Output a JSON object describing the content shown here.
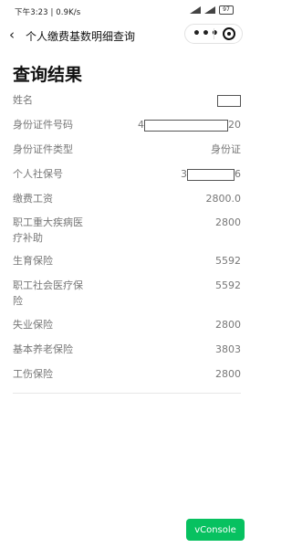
{
  "status": {
    "time_speed": "下午3:23 | 0.9K/s",
    "battery": "97"
  },
  "nav": {
    "title": "个人缴费基数明细查询",
    "more": "•••"
  },
  "page": {
    "title": "查询结果"
  },
  "rows": [
    {
      "label": "姓名",
      "value_prefix": "",
      "value_suffix": ""
    },
    {
      "label": "身份证件号码",
      "value_prefix": "4",
      "value_suffix": "20"
    },
    {
      "label": "身份证件类型",
      "value": "身份证"
    },
    {
      "label": "个人社保号",
      "value_prefix": "3",
      "value_suffix": "6"
    },
    {
      "label": "缴费工资",
      "value": "2800.0"
    },
    {
      "label": "职工重大疾病医疗补助",
      "value": "2800"
    },
    {
      "label": "生育保险",
      "value": "5592"
    },
    {
      "label": "职工社会医疗保险",
      "value": "5592"
    },
    {
      "label": "失业保险",
      "value": "2800"
    },
    {
      "label": "基本养老保险",
      "value": "3803"
    },
    {
      "label": "工伤保险",
      "value": "2800"
    }
  ],
  "vconsole": {
    "label": "vConsole"
  }
}
